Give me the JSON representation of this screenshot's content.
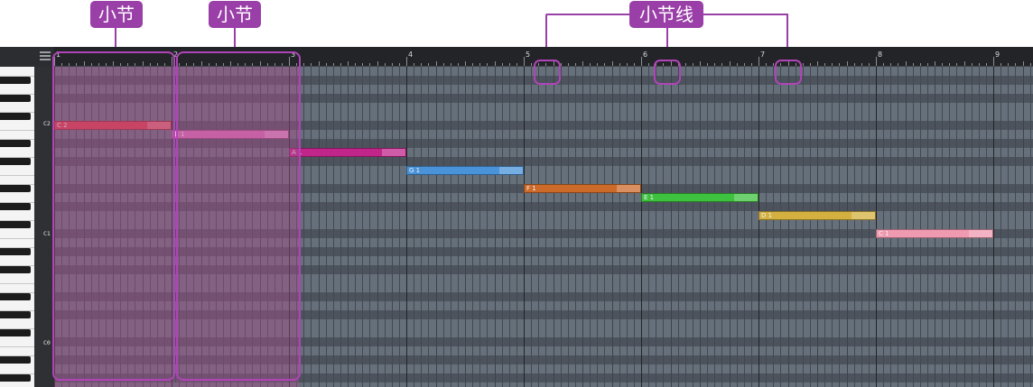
{
  "annotations": {
    "measure_label_1": "小节",
    "measure_label_2": "小节",
    "barline_label": "小节线"
  },
  "ruler": {
    "bar_numbers": [
      "1",
      "2",
      "3",
      "4",
      "5",
      "6",
      "7",
      "8",
      "9"
    ]
  },
  "keyboard": {
    "labels": [
      "C2",
      "C1",
      "C0"
    ]
  },
  "notes": [
    {
      "label": "C 2",
      "color": "#e23b45"
    },
    {
      "label": "B 1",
      "color": "#df6fb8"
    },
    {
      "label": "A 1",
      "color": "#c0268a"
    },
    {
      "label": "G 1",
      "color": "#4a93d8"
    },
    {
      "label": "F 1",
      "color": "#cc6a2a"
    },
    {
      "label": "E 1",
      "color": "#3ec13e"
    },
    {
      "label": "D 1",
      "color": "#d3b03f"
    },
    {
      "label": "C 1",
      "color": "#ef9ab0"
    }
  ],
  "colors": {
    "annotation": "#9a3fa8",
    "highlight": "#b044b8"
  }
}
